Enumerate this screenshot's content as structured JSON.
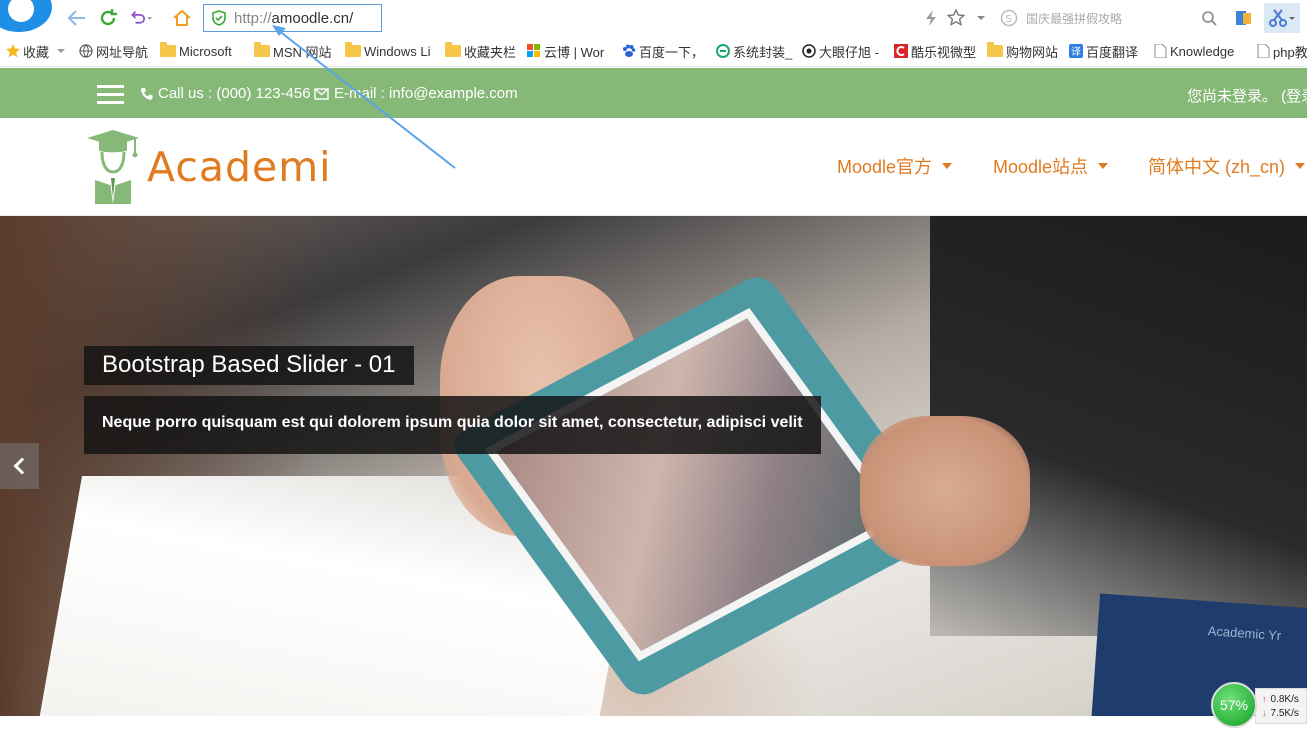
{
  "browser": {
    "address_protocol": "http://",
    "address_host": "amoodle.cn/",
    "search_placeholder": "国庆最强拼假攻略"
  },
  "bookmarks": [
    {
      "label": "收藏",
      "icon": "star-icon"
    },
    {
      "label": "网址导航",
      "icon": "globe-icon"
    },
    {
      "label": "Microsoft",
      "icon": "folder-icon"
    },
    {
      "label": "MSN 网站",
      "icon": "folder-icon"
    },
    {
      "label": "Windows Li",
      "icon": "folder-icon"
    },
    {
      "label": "收藏夹栏",
      "icon": "folder-icon"
    },
    {
      "label": "云博 | Wor",
      "icon": "windows-icon"
    },
    {
      "label": "百度一下，",
      "icon": "baidu-paw-icon"
    },
    {
      "label": "系统封装_",
      "icon": "e-icon"
    },
    {
      "label": "大眼仔旭 -",
      "icon": "eye-icon"
    },
    {
      "label": "酷乐视微型",
      "icon": "red-c-icon"
    },
    {
      "label": "购物网站",
      "icon": "folder-icon"
    },
    {
      "label": "百度翻译",
      "icon": "translate-icon"
    },
    {
      "label": "Knowledge",
      "icon": "page-icon"
    },
    {
      "label": "php教",
      "icon": "page-icon"
    }
  ],
  "site_top": {
    "phone": "Call us : (000) 123-456",
    "email": "E-mail : info@example.com",
    "login": "您尚未登录。 (登录"
  },
  "header": {
    "logo_text": "Academi",
    "nav": [
      {
        "label": "Moodle官方"
      },
      {
        "label": "Moodle站点"
      },
      {
        "label": "简体中文 (zh_cn)"
      }
    ]
  },
  "slider": {
    "title": "Bootstrap Based Slider - 01",
    "text": "Neque porro quisquam est qui dolorem ipsum quia dolor sit amet, consectetur, adipisci velit",
    "book_text": "Academic Yr"
  },
  "speed_widget": {
    "percent": "57%",
    "upload": "0.8K/s",
    "download": "7.5K/s"
  },
  "colors": {
    "top_strip": "#86b877",
    "accent": "#e07b1f",
    "address_border": "#5a9fdc"
  }
}
